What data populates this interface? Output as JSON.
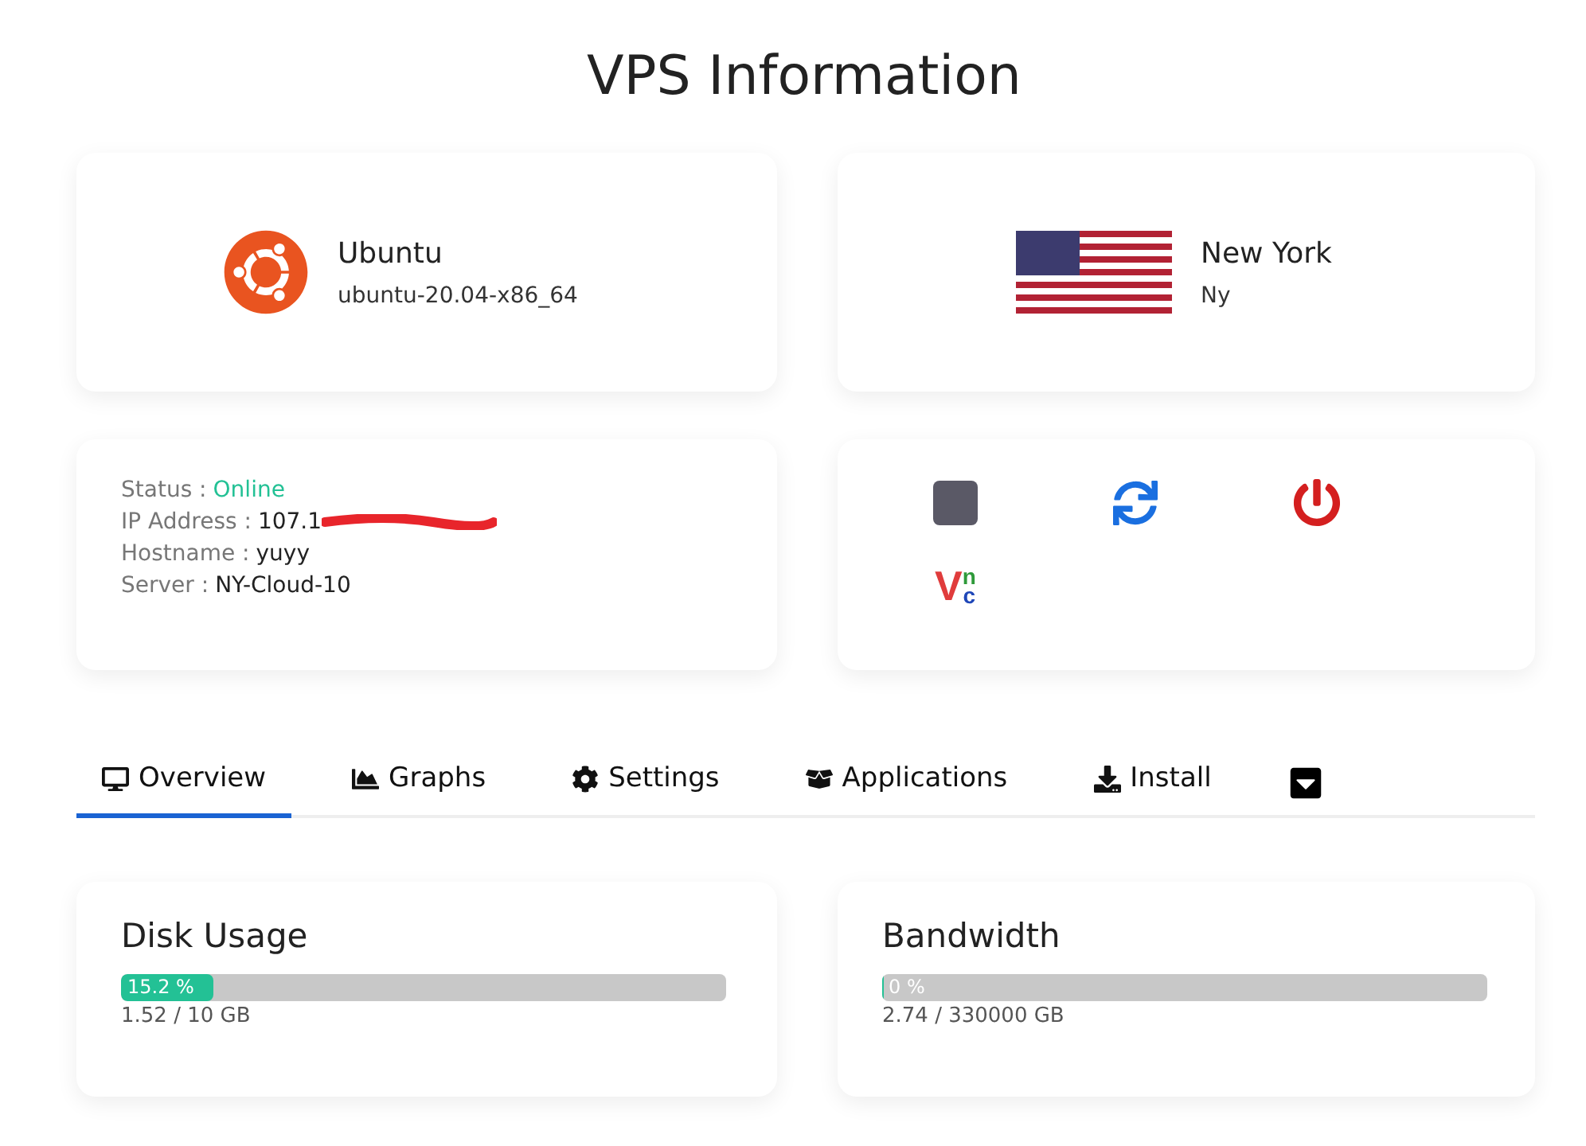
{
  "title": "VPS Information",
  "os": {
    "name": "Ubuntu",
    "version": "ubuntu-20.04-x86_64"
  },
  "location": {
    "city": "New York",
    "region": "Ny"
  },
  "details": [
    {
      "label": "Status :",
      "value": "Online",
      "kind": "status"
    },
    {
      "label": "IP Address :",
      "value": "107.1",
      "kind": "redacted"
    },
    {
      "label": "Hostname :",
      "value": "yuyy",
      "kind": "plain"
    },
    {
      "label": "Server :",
      "value": "NY-Cloud-10",
      "kind": "plain"
    }
  ],
  "actions": [
    {
      "kind": "stop"
    },
    {
      "kind": "restart"
    },
    {
      "kind": "power"
    },
    {
      "kind": "vnc",
      "letters": [
        "V",
        "n",
        "c"
      ]
    }
  ],
  "tabs": [
    {
      "label": "Overview",
      "kind": "desktop",
      "selected": true
    },
    {
      "label": "Graphs",
      "kind": "chart",
      "selected": false
    },
    {
      "label": "Settings",
      "kind": "gear",
      "selected": false
    },
    {
      "label": "Applications",
      "kind": "box",
      "selected": false
    },
    {
      "label": "Install",
      "kind": "download",
      "selected": false
    }
  ],
  "usage": [
    {
      "title": "Disk Usage",
      "percent": "15.2 %",
      "level": 0.152,
      "amount": "1.52 / 10 GB"
    },
    {
      "title": "Bandwidth",
      "percent": "0 %",
      "level": 0,
      "amount": "2.74 / 330000 GB"
    }
  ]
}
